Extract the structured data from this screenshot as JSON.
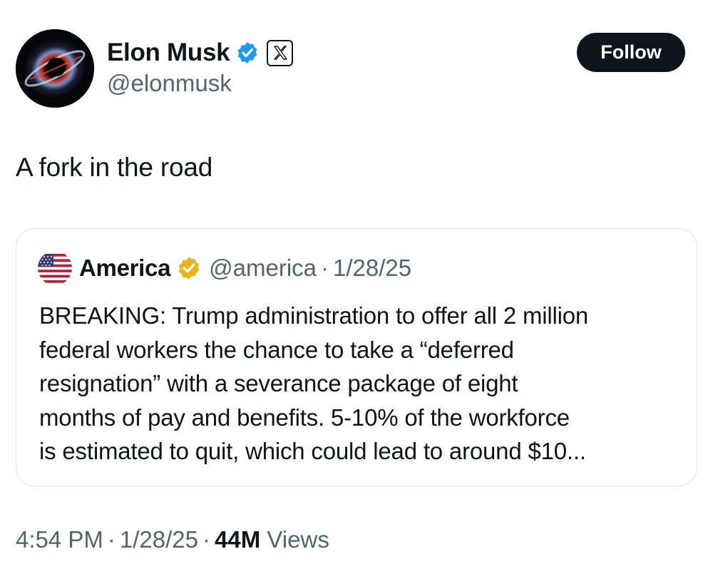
{
  "author": {
    "name": "Elon Musk",
    "handle": "@elonmusk",
    "verified": "blue",
    "affiliate_icon": "x-logo-icon"
  },
  "follow_button": {
    "label": "Follow"
  },
  "tweet": {
    "text": "A fork in the road"
  },
  "quoted_tweet": {
    "author_name": "America",
    "verified": "gold",
    "handle": "@america",
    "separator": "·",
    "date": "1/28/25",
    "lines": [
      "BREAKING: Trump administration to offer all 2 million",
      "federal workers the chance to take a “deferred",
      "resignation” with a severance package of eight",
      "months of pay and benefits. 5-10% of the workforce",
      "is estimated to quit, which could lead to around $10..."
    ]
  },
  "meta": {
    "time": "4:54 PM",
    "separator": "·",
    "date": "1/28/25",
    "views_count": "44M",
    "views_label": "Views"
  },
  "colors": {
    "text": "#0f1419",
    "secondary": "#536471",
    "verified_blue": "#1d9bf0",
    "verified_gold": "#e2b719",
    "border": "#dfe3e6"
  }
}
